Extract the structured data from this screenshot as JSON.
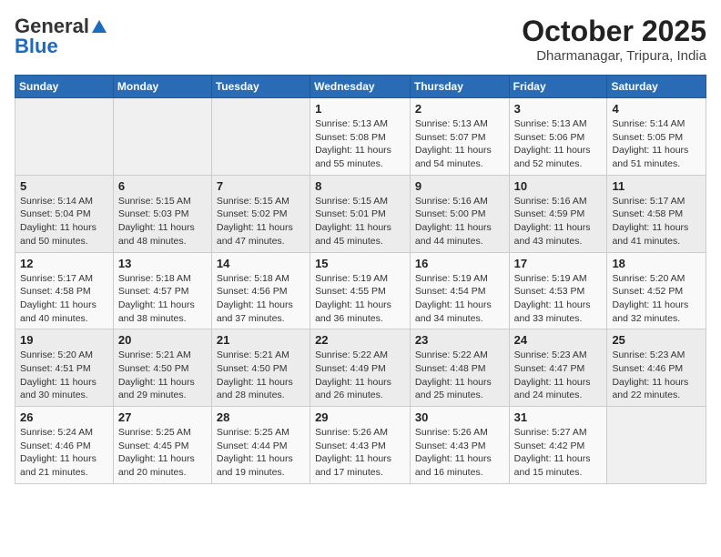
{
  "header": {
    "logo_general": "General",
    "logo_blue": "Blue",
    "month_title": "October 2025",
    "subtitle": "Dharmanagar, Tripura, India"
  },
  "weekdays": [
    "Sunday",
    "Monday",
    "Tuesday",
    "Wednesday",
    "Thursday",
    "Friday",
    "Saturday"
  ],
  "weeks": [
    [
      {
        "day": "",
        "info": ""
      },
      {
        "day": "",
        "info": ""
      },
      {
        "day": "",
        "info": ""
      },
      {
        "day": "1",
        "info": "Sunrise: 5:13 AM\nSunset: 5:08 PM\nDaylight: 11 hours\nand 55 minutes."
      },
      {
        "day": "2",
        "info": "Sunrise: 5:13 AM\nSunset: 5:07 PM\nDaylight: 11 hours\nand 54 minutes."
      },
      {
        "day": "3",
        "info": "Sunrise: 5:13 AM\nSunset: 5:06 PM\nDaylight: 11 hours\nand 52 minutes."
      },
      {
        "day": "4",
        "info": "Sunrise: 5:14 AM\nSunset: 5:05 PM\nDaylight: 11 hours\nand 51 minutes."
      }
    ],
    [
      {
        "day": "5",
        "info": "Sunrise: 5:14 AM\nSunset: 5:04 PM\nDaylight: 11 hours\nand 50 minutes."
      },
      {
        "day": "6",
        "info": "Sunrise: 5:15 AM\nSunset: 5:03 PM\nDaylight: 11 hours\nand 48 minutes."
      },
      {
        "day": "7",
        "info": "Sunrise: 5:15 AM\nSunset: 5:02 PM\nDaylight: 11 hours\nand 47 minutes."
      },
      {
        "day": "8",
        "info": "Sunrise: 5:15 AM\nSunset: 5:01 PM\nDaylight: 11 hours\nand 45 minutes."
      },
      {
        "day": "9",
        "info": "Sunrise: 5:16 AM\nSunset: 5:00 PM\nDaylight: 11 hours\nand 44 minutes."
      },
      {
        "day": "10",
        "info": "Sunrise: 5:16 AM\nSunset: 4:59 PM\nDaylight: 11 hours\nand 43 minutes."
      },
      {
        "day": "11",
        "info": "Sunrise: 5:17 AM\nSunset: 4:58 PM\nDaylight: 11 hours\nand 41 minutes."
      }
    ],
    [
      {
        "day": "12",
        "info": "Sunrise: 5:17 AM\nSunset: 4:58 PM\nDaylight: 11 hours\nand 40 minutes."
      },
      {
        "day": "13",
        "info": "Sunrise: 5:18 AM\nSunset: 4:57 PM\nDaylight: 11 hours\nand 38 minutes."
      },
      {
        "day": "14",
        "info": "Sunrise: 5:18 AM\nSunset: 4:56 PM\nDaylight: 11 hours\nand 37 minutes."
      },
      {
        "day": "15",
        "info": "Sunrise: 5:19 AM\nSunset: 4:55 PM\nDaylight: 11 hours\nand 36 minutes."
      },
      {
        "day": "16",
        "info": "Sunrise: 5:19 AM\nSunset: 4:54 PM\nDaylight: 11 hours\nand 34 minutes."
      },
      {
        "day": "17",
        "info": "Sunrise: 5:19 AM\nSunset: 4:53 PM\nDaylight: 11 hours\nand 33 minutes."
      },
      {
        "day": "18",
        "info": "Sunrise: 5:20 AM\nSunset: 4:52 PM\nDaylight: 11 hours\nand 32 minutes."
      }
    ],
    [
      {
        "day": "19",
        "info": "Sunrise: 5:20 AM\nSunset: 4:51 PM\nDaylight: 11 hours\nand 30 minutes."
      },
      {
        "day": "20",
        "info": "Sunrise: 5:21 AM\nSunset: 4:50 PM\nDaylight: 11 hours\nand 29 minutes."
      },
      {
        "day": "21",
        "info": "Sunrise: 5:21 AM\nSunset: 4:50 PM\nDaylight: 11 hours\nand 28 minutes."
      },
      {
        "day": "22",
        "info": "Sunrise: 5:22 AM\nSunset: 4:49 PM\nDaylight: 11 hours\nand 26 minutes."
      },
      {
        "day": "23",
        "info": "Sunrise: 5:22 AM\nSunset: 4:48 PM\nDaylight: 11 hours\nand 25 minutes."
      },
      {
        "day": "24",
        "info": "Sunrise: 5:23 AM\nSunset: 4:47 PM\nDaylight: 11 hours\nand 24 minutes."
      },
      {
        "day": "25",
        "info": "Sunrise: 5:23 AM\nSunset: 4:46 PM\nDaylight: 11 hours\nand 22 minutes."
      }
    ],
    [
      {
        "day": "26",
        "info": "Sunrise: 5:24 AM\nSunset: 4:46 PM\nDaylight: 11 hours\nand 21 minutes."
      },
      {
        "day": "27",
        "info": "Sunrise: 5:25 AM\nSunset: 4:45 PM\nDaylight: 11 hours\nand 20 minutes."
      },
      {
        "day": "28",
        "info": "Sunrise: 5:25 AM\nSunset: 4:44 PM\nDaylight: 11 hours\nand 19 minutes."
      },
      {
        "day": "29",
        "info": "Sunrise: 5:26 AM\nSunset: 4:43 PM\nDaylight: 11 hours\nand 17 minutes."
      },
      {
        "day": "30",
        "info": "Sunrise: 5:26 AM\nSunset: 4:43 PM\nDaylight: 11 hours\nand 16 minutes."
      },
      {
        "day": "31",
        "info": "Sunrise: 5:27 AM\nSunset: 4:42 PM\nDaylight: 11 hours\nand 15 minutes."
      },
      {
        "day": "",
        "info": ""
      }
    ]
  ]
}
